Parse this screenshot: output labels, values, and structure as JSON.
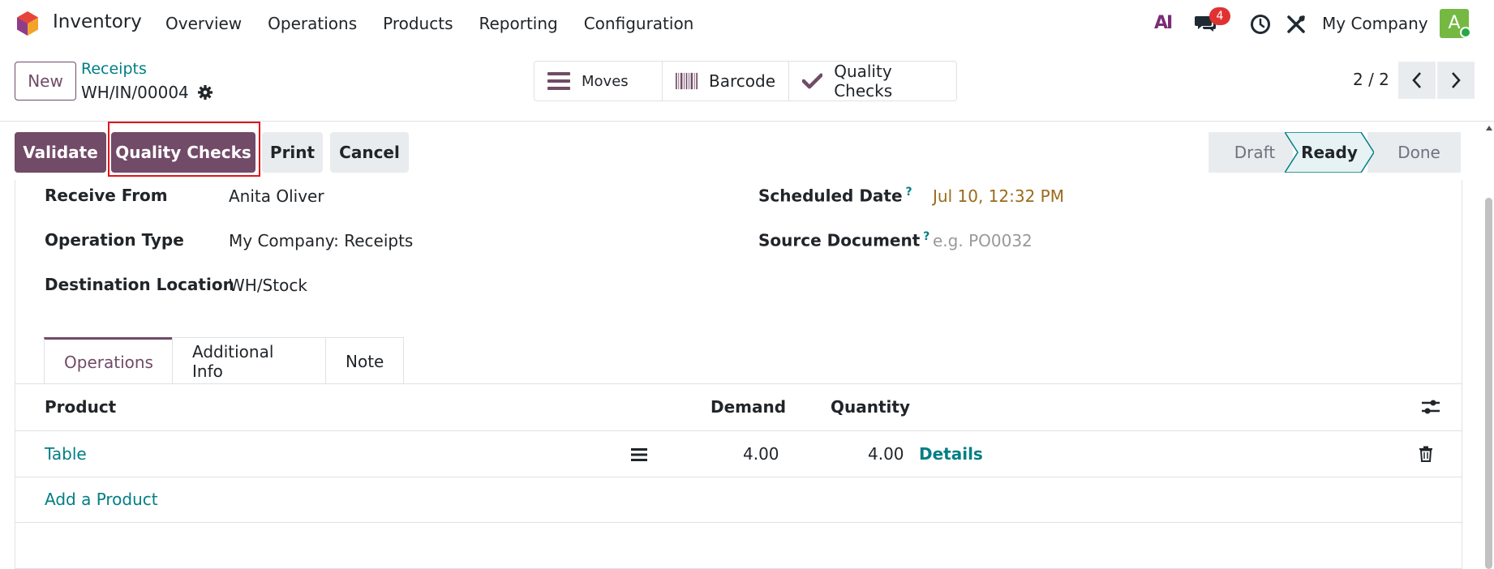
{
  "app": {
    "name": "Inventory"
  },
  "nav": {
    "items": [
      "Overview",
      "Operations",
      "Products",
      "Reporting",
      "Configuration"
    ]
  },
  "systray": {
    "ai_label": "AI",
    "chat_count": "4",
    "company": "My Company",
    "avatar_initial": "A"
  },
  "control": {
    "new_label": "New",
    "breadcrumb": "Receipts",
    "record_name": "WH/IN/00004",
    "smart_buttons": [
      "Moves",
      "Barcode",
      "Quality Checks"
    ],
    "pager": "2 / 2"
  },
  "actions": {
    "validate": "Validate",
    "quality_checks": "Quality Checks",
    "print": "Print",
    "cancel": "Cancel"
  },
  "stages": {
    "draft": "Draft",
    "ready": "Ready",
    "done": "Done",
    "current": "Ready"
  },
  "form": {
    "receive_from_label": "Receive From",
    "receive_from": "Anita Oliver",
    "operation_type_label": "Operation Type",
    "operation_type": "My Company: Receipts",
    "destination_label": "Destination Location",
    "destination": "WH/Stock",
    "scheduled_date_label": "Scheduled Date",
    "scheduled_date": "Jul 10, 12:32 PM",
    "source_document_label": "Source Document",
    "source_document_placeholder": "e.g. PO0032",
    "help_mark": "?"
  },
  "tabs": [
    "Operations",
    "Additional Info",
    "Note"
  ],
  "table": {
    "headers": {
      "product": "Product",
      "demand": "Demand",
      "quantity": "Quantity"
    },
    "rows": [
      {
        "product": "Table",
        "demand": "4.00",
        "quantity": "4.00",
        "details": "Details"
      }
    ],
    "add_product": "Add a Product"
  },
  "colors": {
    "brand": "#714b67",
    "link": "#017e84",
    "date": "#9a6b1c",
    "highlight": "#e0151b"
  }
}
